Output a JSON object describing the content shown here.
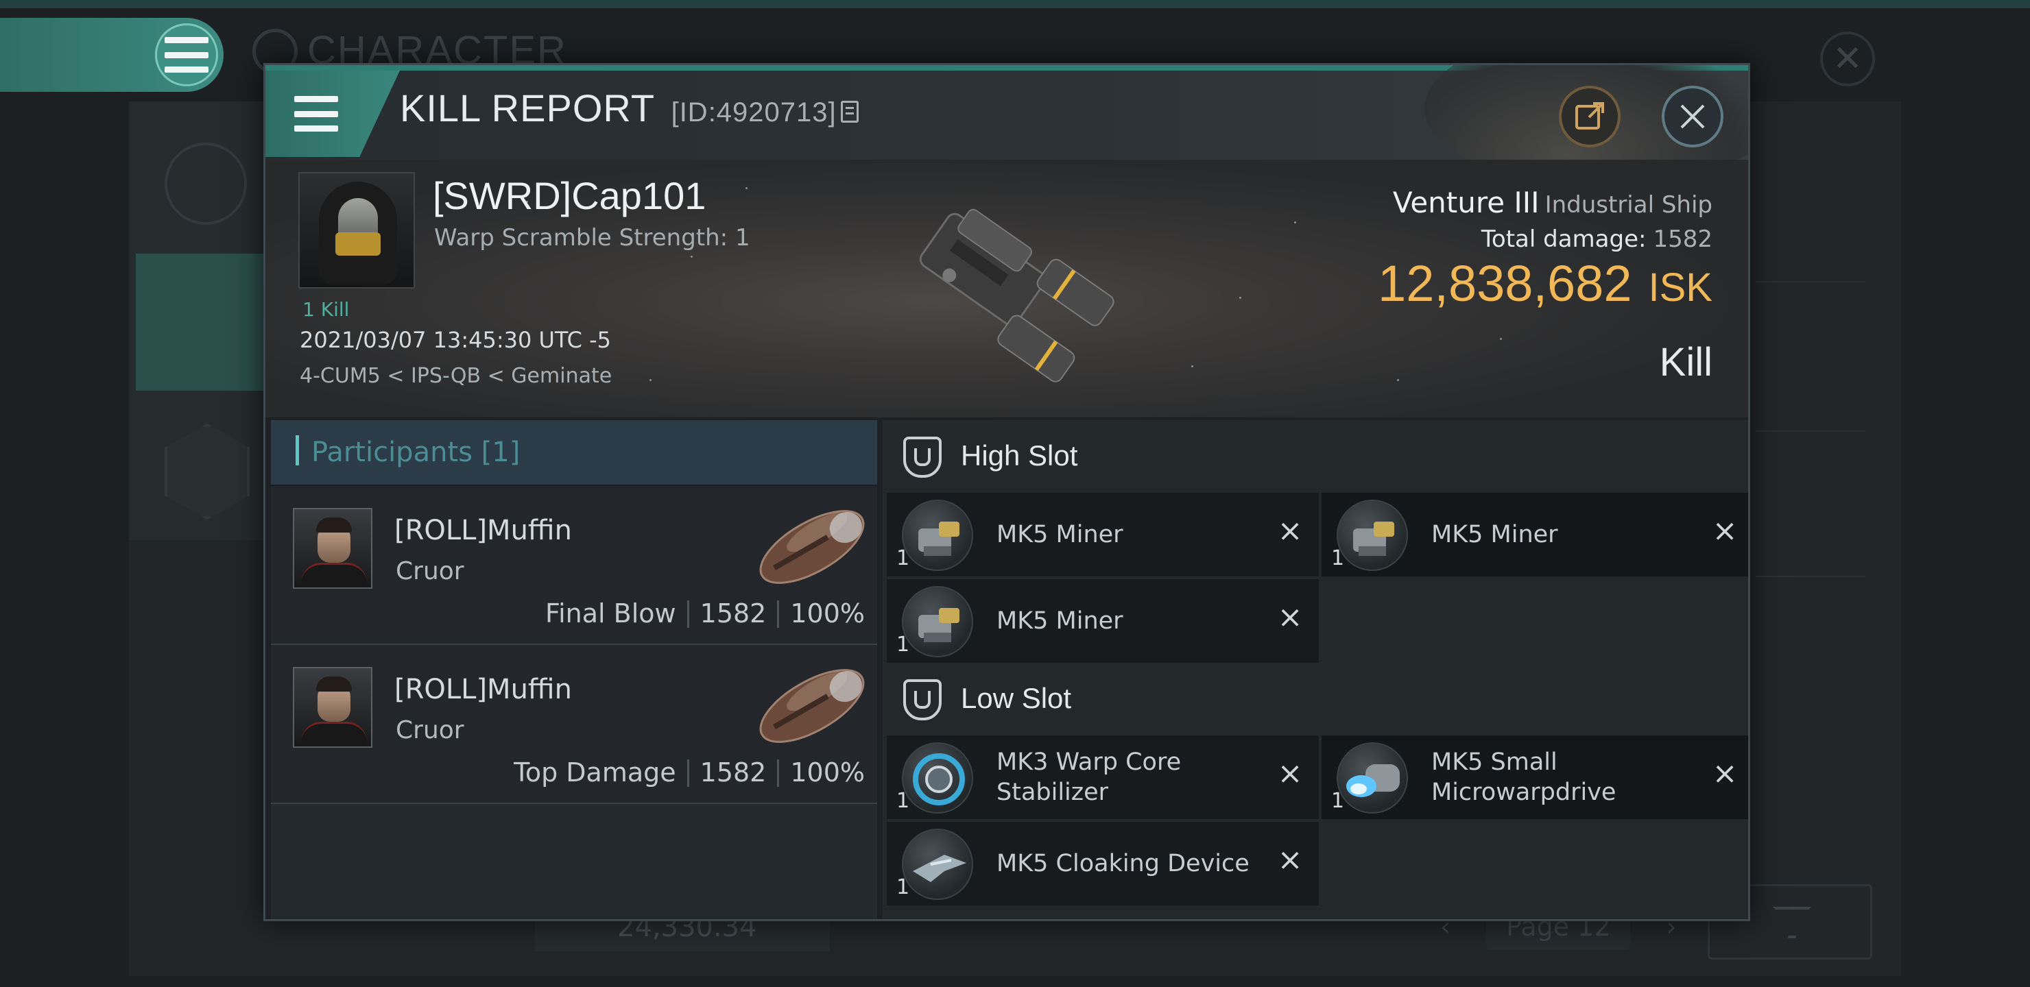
{
  "background": {
    "title": "CHARACTER",
    "bottom_number": "24,330.34",
    "page_label": "Page 12"
  },
  "dialog": {
    "title": "KILL REPORT",
    "id_text": "[ID:4920713]"
  },
  "victim": {
    "name": "[SWRD]Cap101",
    "warp_scramble": "Warp Scramble Strength: 1",
    "kills_tag": "1 Kill",
    "time": "2021/03/07 13:45:30 UTC -5",
    "location": "4-CUM5 < IPS-QB < Geminate",
    "ship_name": "Venture III",
    "ship_class": "Industrial Ship",
    "total_damage_label": "Total damage:",
    "total_damage": "1582",
    "isk_value": "12,838,682",
    "isk_unit": "ISK",
    "result": "Kill"
  },
  "participants": {
    "header": "Participants [1]",
    "items": [
      {
        "name": "[ROLL]Muffin",
        "ship": "Cruor",
        "role": "Final Blow",
        "damage": "1582",
        "percent": "100%"
      },
      {
        "name": "[ROLL]Muffin",
        "ship": "Cruor",
        "role": "Top Damage",
        "damage": "1582",
        "percent": "100%"
      }
    ]
  },
  "slots": {
    "high": {
      "title": "High Slot",
      "modules": [
        {
          "name": "MK5 Miner",
          "qty": "1",
          "icon": "miner-icon"
        },
        {
          "name": "MK5 Miner",
          "qty": "1",
          "icon": "miner-icon"
        },
        {
          "name": "MK5 Miner",
          "qty": "1",
          "icon": "miner-icon"
        }
      ]
    },
    "low": {
      "title": "Low Slot",
      "modules": [
        {
          "name": "MK3 Warp Core Stabilizer",
          "qty": "1",
          "icon": "warp-core-stabilizer-icon"
        },
        {
          "name": "MK5 Small Microwarpdrive",
          "qty": "1",
          "icon": "microwarpdrive-icon"
        },
        {
          "name": "MK5 Cloaking Device",
          "qty": "1",
          "icon": "cloaking-device-icon"
        }
      ]
    },
    "destroyed_mark": "×"
  },
  "colors": {
    "accent_teal": "#2f7e74",
    "isk_gold": "#f2b857",
    "participants_header": "#4c8c95"
  }
}
